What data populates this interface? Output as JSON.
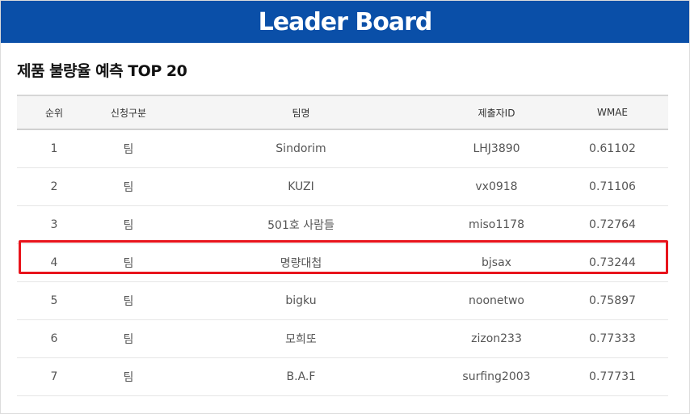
{
  "header": {
    "title": "Leader Board",
    "background_color": "#0a4fa8"
  },
  "section": {
    "title": "제품 불량율 예측 TOP 20"
  },
  "table": {
    "columns": [
      "순위",
      "신청구분",
      "팀명",
      "제출자ID",
      "WMAE"
    ],
    "rows": [
      {
        "rank": "1",
        "type": "팀",
        "team": "Sindorim",
        "submitter": "LHJ3890",
        "wmae": "0.61102"
      },
      {
        "rank": "2",
        "type": "팀",
        "team": "KUZI",
        "submitter": "vx0918",
        "wmae": "0.71106"
      },
      {
        "rank": "3",
        "type": "팀",
        "team": "501호 사람들",
        "submitter": "miso1178",
        "wmae": "0.72764"
      },
      {
        "rank": "4",
        "type": "팀",
        "team": "명량대첩",
        "submitter": "bjsax",
        "wmae": "0.73244"
      },
      {
        "rank": "5",
        "type": "팀",
        "team": "bigku",
        "submitter": "noonetwo",
        "wmae": "0.75897"
      },
      {
        "rank": "6",
        "type": "팀",
        "team": "모희또",
        "submitter": "zizon233",
        "wmae": "0.77333"
      },
      {
        "rank": "7",
        "type": "팀",
        "team": "B.A.F",
        "submitter": "surfing2003",
        "wmae": "0.77731"
      }
    ],
    "highlighted_rank": "4",
    "highlight_color": "#e8141c"
  }
}
